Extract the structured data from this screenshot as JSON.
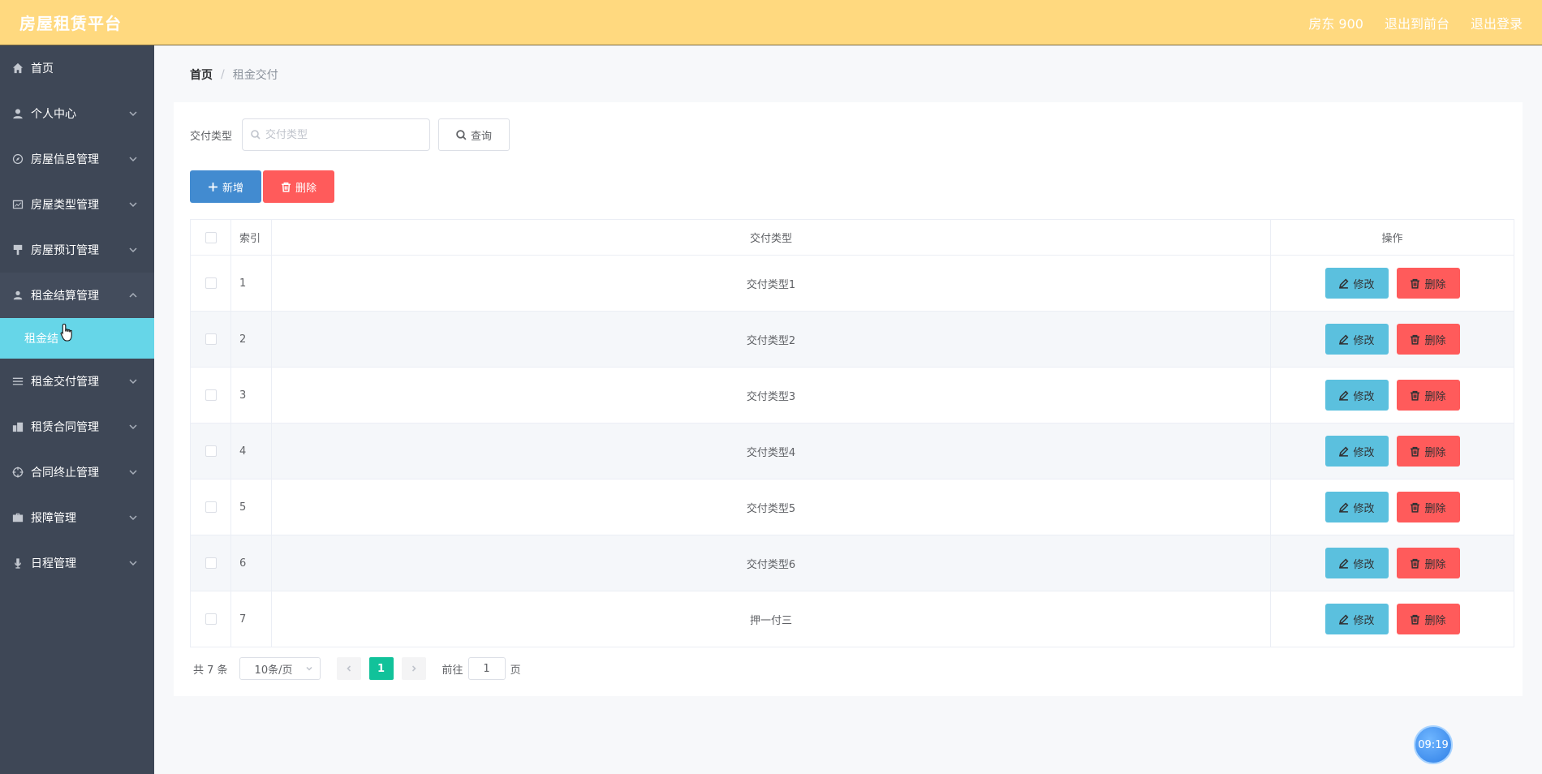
{
  "header": {
    "brand": "房屋租赁平台",
    "user": "房东 900",
    "to_front": "退出到前台",
    "logout": "退出登录"
  },
  "sidebar": {
    "items": [
      {
        "label": "首页",
        "icon": "home-icon"
      },
      {
        "label": "个人中心",
        "icon": "user-icon"
      },
      {
        "label": "房屋信息管理",
        "icon": "compass-icon"
      },
      {
        "label": "房屋类型管理",
        "icon": "chart-icon"
      },
      {
        "label": "房屋预订管理",
        "icon": "brush-icon"
      },
      {
        "label": "租金结算管理",
        "icon": "person-icon"
      },
      {
        "label": "租金交付管理",
        "icon": "list-icon"
      },
      {
        "label": "租赁合同管理",
        "icon": "building-icon"
      },
      {
        "label": "合同终止管理",
        "icon": "target-icon"
      },
      {
        "label": "报障管理",
        "icon": "briefcase-icon"
      },
      {
        "label": "日程管理",
        "icon": "mic-icon"
      }
    ],
    "submenu_label": "租金结"
  },
  "breadcrumb": {
    "home": "首页",
    "separator": "/",
    "current": "租金交付"
  },
  "search": {
    "label": "交付类型",
    "placeholder": "交付类型",
    "query_button": "查询"
  },
  "actions": {
    "add": "新增",
    "delete": "删除"
  },
  "table": {
    "headers": {
      "index": "索引",
      "type": "交付类型",
      "operation": "操作"
    },
    "rows": [
      {
        "index": "1",
        "type": "交付类型1"
      },
      {
        "index": "2",
        "type": "交付类型2"
      },
      {
        "index": "3",
        "type": "交付类型3"
      },
      {
        "index": "4",
        "type": "交付类型4"
      },
      {
        "index": "5",
        "type": "交付类型5"
      },
      {
        "index": "6",
        "type": "交付类型6"
      },
      {
        "index": "7",
        "type": "押一付三"
      }
    ],
    "edit_label": "修改",
    "delete_label": "删除"
  },
  "pagination": {
    "total": "共 7 条",
    "page_size": "10条/页",
    "current_page": "1",
    "goto_label": "前往",
    "goto_value": "1",
    "page_unit": "页"
  },
  "clock": "09:19",
  "colors": {
    "header_bg": "#ffd97f",
    "sidebar_bg": "#3e4756",
    "submenu_active": "#66d6e8",
    "primary": "#428bd0",
    "danger": "#ff5b5b",
    "edit": "#5bc0de",
    "pager_active": "#11c29a"
  }
}
